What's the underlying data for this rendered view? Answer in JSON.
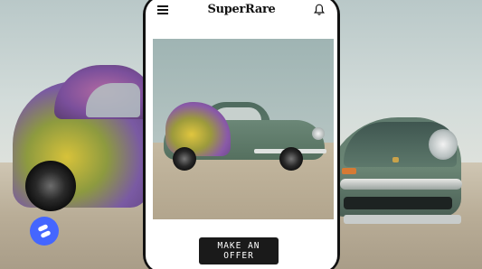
{
  "app": {
    "logo_text": "SuperRare"
  },
  "header": {
    "menu_icon": "hamburger-menu-icon",
    "notifications_icon": "bell-icon"
  },
  "artwork": {
    "description_icon": "artwork-image"
  },
  "actions": {
    "offer_label_line1": "MAKE AN",
    "offer_label_line2": "OFFER"
  },
  "fab": {
    "icon": "wallet-logo-icon",
    "color": "#4466ff"
  }
}
